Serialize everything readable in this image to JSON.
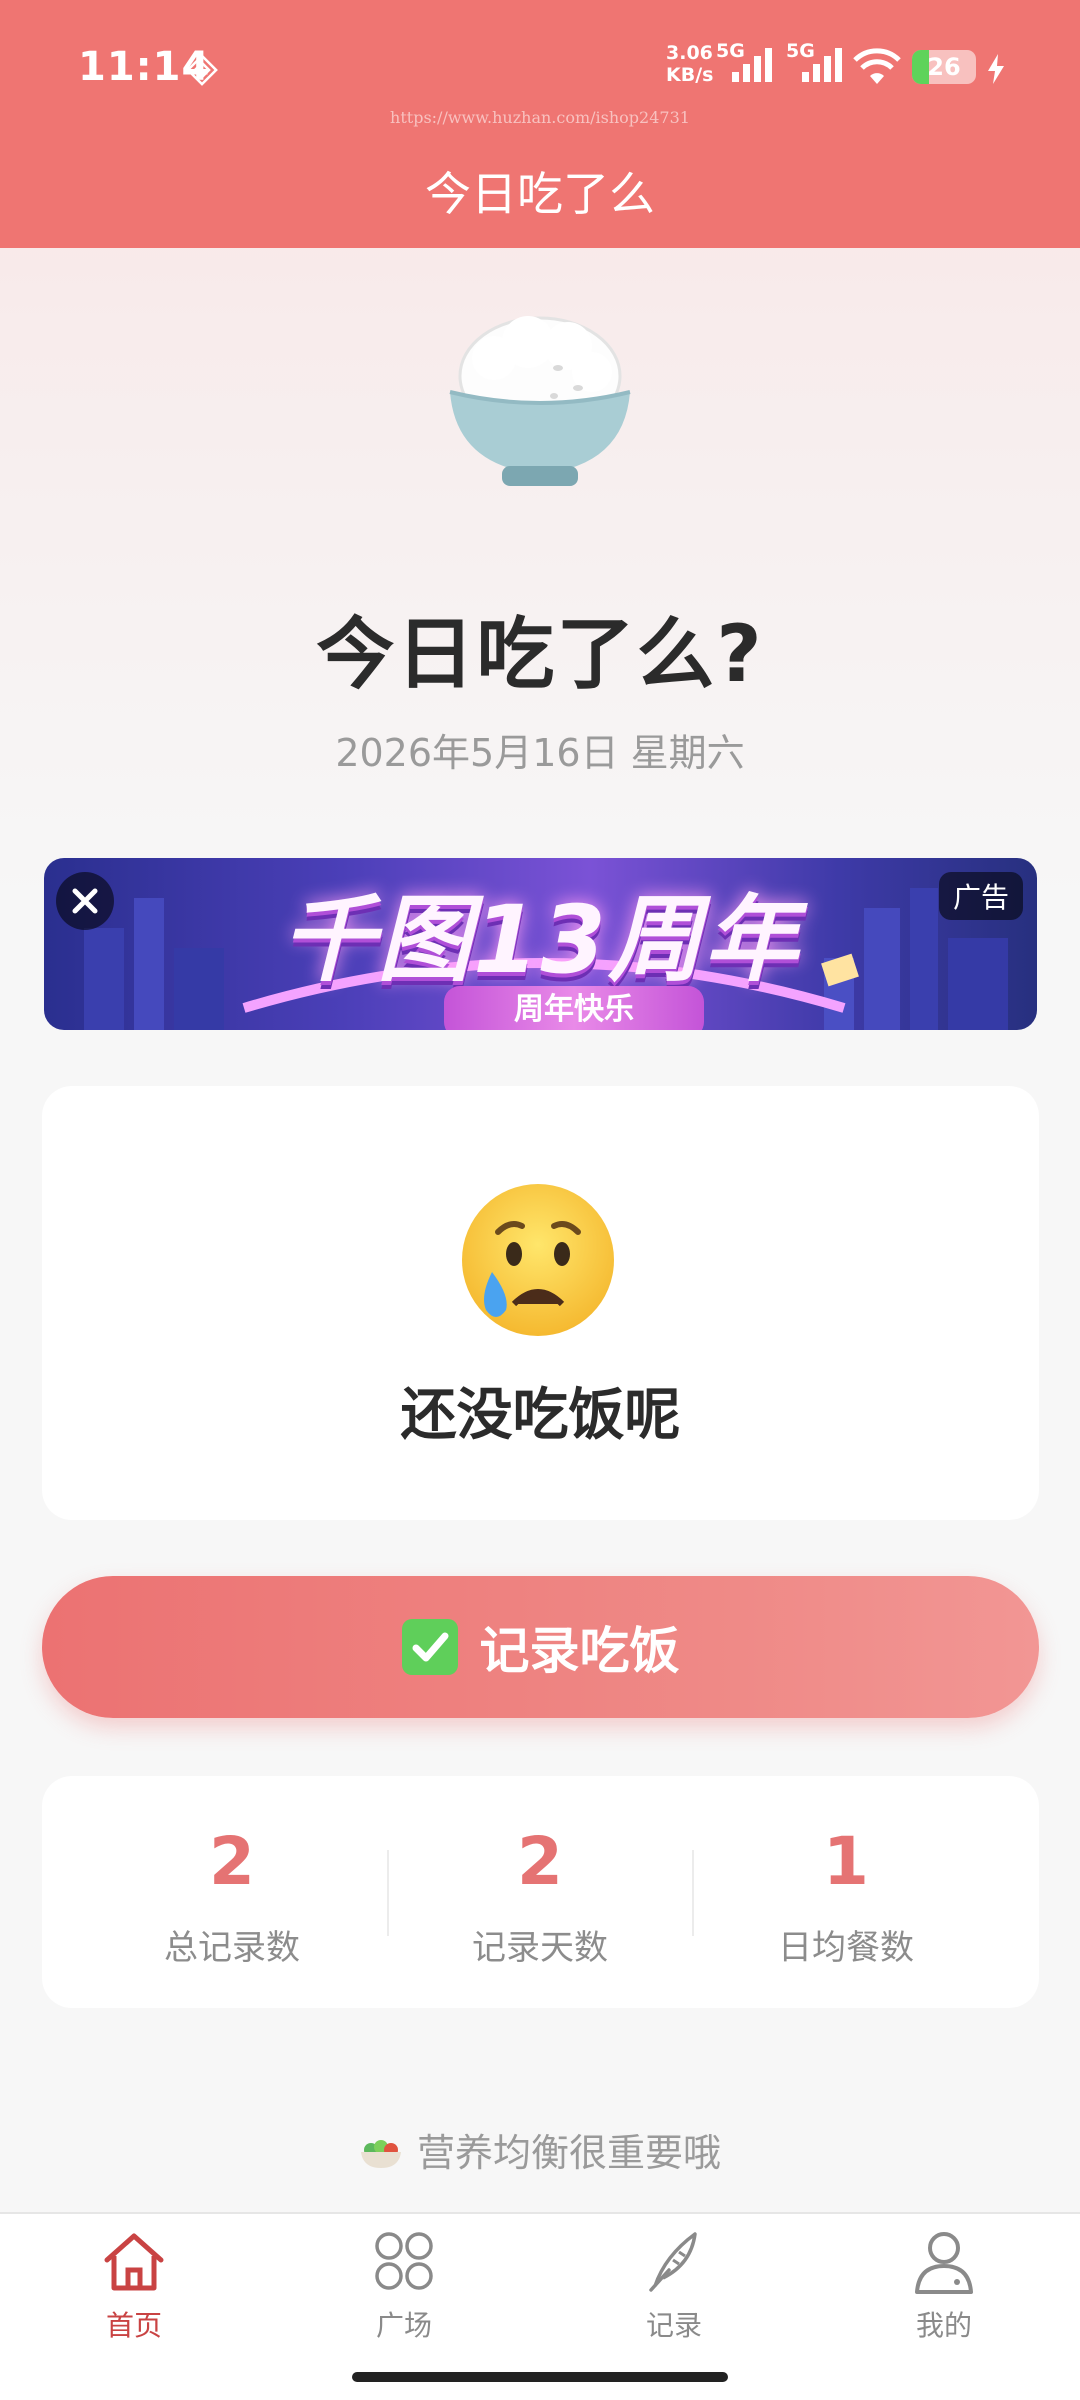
{
  "status_bar": {
    "time": "11:14",
    "net_speed_value": "3.06",
    "net_speed_unit": "KB/s",
    "sim1_label": "5G",
    "sim2_label": "5G",
    "battery_level": "26",
    "battery_fraction": 0.26
  },
  "header": {
    "watermark": "https://www.huzhan.com/ishop24731",
    "title": "今日吃了么"
  },
  "hero": {
    "icon": "rice-bowl-icon",
    "title": "今日吃了么?",
    "date": "2026年5月16日 星期六"
  },
  "ad": {
    "headline": "千图13周年",
    "sub": "周年快乐",
    "tag": "广告"
  },
  "status_card": {
    "icon": "crying-face-icon",
    "text": "还没吃饭呢"
  },
  "record_button": {
    "icon": "check-mark-icon",
    "label": "记录吃饭"
  },
  "stats": [
    {
      "value": "2",
      "label": "总记录数"
    },
    {
      "value": "2",
      "label": "记录天数"
    },
    {
      "value": "1",
      "label": "日均餐数"
    }
  ],
  "tip": {
    "icon": "salad-icon",
    "text": "营养均衡很重要哦"
  },
  "tabbar": {
    "items": [
      {
        "label": "首页",
        "icon": "home-icon",
        "active": true
      },
      {
        "label": "广场",
        "icon": "grid-icon",
        "active": false
      },
      {
        "label": "记录",
        "icon": "quill-icon",
        "active": false
      },
      {
        "label": "我的",
        "icon": "user-icon",
        "active": false
      }
    ]
  },
  "colors": {
    "primary": "#ef7572",
    "stat_value": "#e57373",
    "active_tab": "#c94343"
  }
}
